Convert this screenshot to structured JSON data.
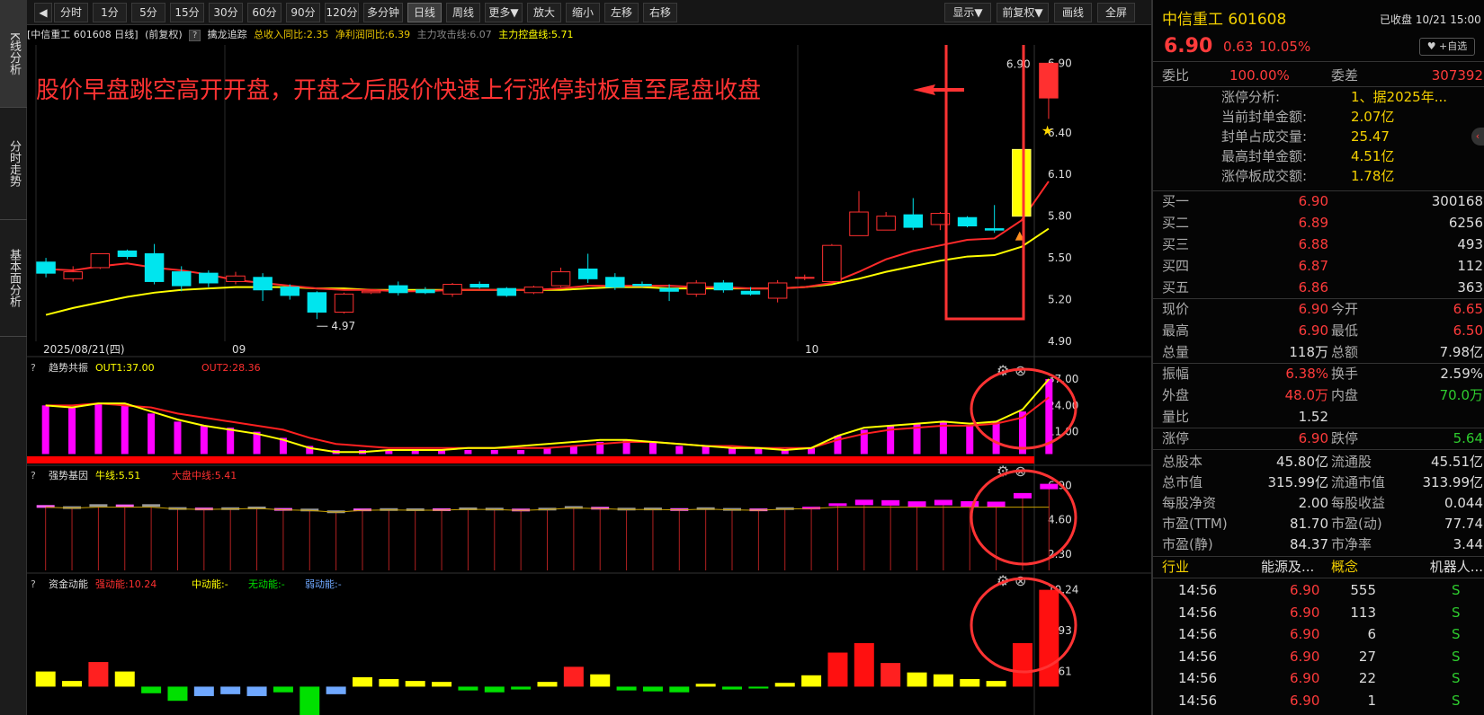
{
  "left_tabs": [
    "K线分析",
    "分时走势",
    "基本面分析"
  ],
  "toolbar": {
    "back_icon": "back-arrow-icon",
    "buttons": [
      "分时",
      "1分",
      "5分",
      "15分",
      "30分",
      "60分",
      "90分",
      "120分",
      "多分钟",
      "日线",
      "周线",
      "更多▼",
      "放大",
      "缩小",
      "左移",
      "右移"
    ],
    "active": "日线",
    "right_buttons": [
      "显示▼",
      "前复权▼",
      "画线",
      "全屏"
    ]
  },
  "info": {
    "name": "[中信重工 601608 日线]",
    "adj": "(前复权)",
    "q": "?",
    "indicator": "擒龙追踪",
    "t1": "总收入同比:2.35",
    "t2": "净利润同比:6.39",
    "t3": "主力攻击线:6.07",
    "t4": "主力控盘线:5.71"
  },
  "annotation": "股价早盘跳空高开开盘，开盘之后股价快速上行涨停封板直至尾盘收盘",
  "colors": {
    "up": "#ff3030",
    "down": "#00e5ee",
    "ma1": "#ff2a2a",
    "ma2": "#ffff00",
    "bar": "#ff00ff"
  },
  "chart_data": {
    "type": "candlestick",
    "x_labels": [
      "2025/08/21(四)",
      "09",
      "10"
    ],
    "y_ticks": [
      "6.90",
      "6.40",
      "6.10",
      "5.80",
      "5.50",
      "5.20",
      "4.90"
    ],
    "ylim": [
      4.9,
      6.98
    ],
    "labels": {
      "high_label": "6.90",
      "low_label": "4.97"
    },
    "candles": [
      [
        5.47,
        5.39,
        5.5,
        5.36
      ],
      [
        5.35,
        5.4,
        5.44,
        5.33
      ],
      [
        5.43,
        5.53,
        5.53,
        5.42
      ],
      [
        5.55,
        5.51,
        5.56,
        5.49
      ],
      [
        5.53,
        5.33,
        5.6,
        5.31
      ],
      [
        5.4,
        5.3,
        5.44,
        5.26
      ],
      [
        5.39,
        5.32,
        5.41,
        5.29
      ],
      [
        5.33,
        5.37,
        5.4,
        5.31
      ],
      [
        5.36,
        5.27,
        5.39,
        5.19
      ],
      [
        5.29,
        5.23,
        5.31,
        5.2
      ],
      [
        5.25,
        5.11,
        5.26,
        5.06
      ],
      [
        5.11,
        5.24,
        5.25,
        5.1
      ],
      [
        5.25,
        5.26,
        5.27,
        5.24
      ],
      [
        5.3,
        5.25,
        5.33,
        5.23
      ],
      [
        5.27,
        5.25,
        5.29,
        5.24
      ],
      [
        5.24,
        5.31,
        5.32,
        5.22
      ],
      [
        5.31,
        5.29,
        5.33,
        5.28
      ],
      [
        5.28,
        5.23,
        5.29,
        5.22
      ],
      [
        5.25,
        5.29,
        5.3,
        5.24
      ],
      [
        5.3,
        5.4,
        5.43,
        5.29
      ],
      [
        5.42,
        5.35,
        5.53,
        5.32
      ],
      [
        5.36,
        5.29,
        5.39,
        5.27
      ],
      [
        5.31,
        5.3,
        5.33,
        5.29
      ],
      [
        5.28,
        5.26,
        5.31,
        5.19
      ],
      [
        5.24,
        5.32,
        5.34,
        5.22
      ],
      [
        5.32,
        5.27,
        5.34,
        5.25
      ],
      [
        5.26,
        5.24,
        5.29,
        5.23
      ],
      [
        5.21,
        5.32,
        5.34,
        5.18
      ],
      [
        5.36,
        5.36,
        5.38,
        5.34
      ],
      [
        5.33,
        5.59,
        5.6,
        5.33
      ],
      [
        5.66,
        5.83,
        5.98,
        5.66
      ],
      [
        5.7,
        5.8,
        5.83,
        5.7
      ],
      [
        5.81,
        5.72,
        5.93,
        5.7
      ],
      [
        5.74,
        5.82,
        5.83,
        5.7
      ],
      [
        5.79,
        5.73,
        5.8,
        5.72
      ],
      [
        5.71,
        5.7,
        5.88,
        5.68
      ],
      [
        5.8,
        6.28,
        6.28,
        5.8
      ],
      [
        6.65,
        6.9,
        6.9,
        6.5
      ]
    ],
    "ma1": [
      5.42,
      5.41,
      5.44,
      5.46,
      5.43,
      5.41,
      5.38,
      5.34,
      5.32,
      5.3,
      5.28,
      5.27,
      5.27,
      5.26,
      5.26,
      5.27,
      5.27,
      5.27,
      5.27,
      5.28,
      5.3,
      5.3,
      5.3,
      5.3,
      5.29,
      5.29,
      5.28,
      5.28,
      5.29,
      5.32,
      5.4,
      5.49,
      5.55,
      5.59,
      5.63,
      5.64,
      5.77,
      6.05
    ],
    "ma2": [
      5.09,
      5.14,
      5.18,
      5.22,
      5.25,
      5.27,
      5.28,
      5.29,
      5.29,
      5.29,
      5.28,
      5.28,
      5.27,
      5.27,
      5.27,
      5.27,
      5.27,
      5.27,
      5.27,
      5.27,
      5.28,
      5.29,
      5.29,
      5.28,
      5.28,
      5.28,
      5.28,
      5.28,
      5.29,
      5.31,
      5.35,
      5.4,
      5.44,
      5.48,
      5.51,
      5.52,
      5.58,
      5.71
    ],
    "ind1": {
      "title": "趋势共振",
      "out1": "OUT1:37.00",
      "out2": "OUT2:28.36",
      "ticks": [
        "37.00",
        "24.00",
        "11.00"
      ],
      "ylim": [
        -2,
        37
      ],
      "bars": [
        24,
        23,
        25,
        25,
        20,
        16,
        14,
        13,
        11,
        8,
        4,
        2,
        2,
        2,
        2,
        2,
        2,
        2,
        2,
        3,
        4,
        6,
        7,
        6,
        4,
        4,
        3,
        3,
        2,
        3,
        9,
        12,
        14,
        15,
        16,
        14,
        16,
        21,
        37
      ],
      "line1": [
        24,
        23,
        25,
        25,
        21,
        17,
        14,
        12,
        10,
        7,
        3,
        1,
        1,
        2,
        2,
        2,
        3,
        3,
        4,
        5,
        6,
        7,
        7,
        6,
        5,
        4,
        3,
        3,
        2,
        3,
        9,
        13,
        14,
        15,
        16,
        15,
        16,
        22,
        37
      ],
      "line2": [
        24,
        24,
        25,
        24,
        23,
        20,
        18,
        16,
        14,
        12,
        8,
        5,
        4,
        3,
        3,
        3,
        3,
        3,
        3,
        3,
        4,
        5,
        6,
        6,
        5,
        4,
        4,
        3,
        3,
        3,
        7,
        10,
        12,
        13,
        14,
        14,
        15,
        18,
        28
      ]
    },
    "ind2": {
      "title": "强势基因",
      "l1": "牛线:5.51",
      "l2": "大盘中线:5.41",
      "ticks": [
        "6.90",
        "4.60",
        "2.30"
      ],
      "ylim": [
        1.2,
        7.3
      ],
      "bars": [
        5.47,
        5.39,
        5.53,
        5.51,
        5.53,
        5.33,
        5.3,
        5.32,
        5.37,
        5.27,
        5.23,
        5.11,
        5.24,
        5.26,
        5.25,
        5.25,
        5.31,
        5.29,
        5.23,
        5.29,
        5.4,
        5.35,
        5.29,
        5.3,
        5.26,
        5.32,
        5.27,
        5.24,
        5.32,
        5.36,
        5.59,
        5.83,
        5.8,
        5.72,
        5.82,
        5.73,
        5.7,
        6.28,
        6.9
      ]
    },
    "ind3": {
      "title": "资金动能",
      "l1": "强动能:10.24",
      "l2": "中动能:-",
      "l3": "无动能:-",
      "l4": "弱动能:-",
      "ticks": [
        "10.24",
        "5.93",
        "1.61"
      ],
      "ylim": [
        -3,
        10.3
      ],
      "bars": [
        1.6,
        0.6,
        2.6,
        1.6,
        -0.7,
        -1.5,
        -1.0,
        -0.8,
        -1.0,
        -0.6,
        -3.0,
        -0.8,
        1.0,
        0.8,
        0.6,
        0.5,
        -0.4,
        -0.6,
        -0.3,
        0.5,
        2.1,
        1.3,
        -0.4,
        -0.5,
        -0.6,
        0.3,
        -0.3,
        -0.2,
        0.4,
        1.2,
        3.6,
        4.6,
        2.5,
        1.5,
        1.3,
        0.8,
        0.6,
        4.6,
        10.24
      ]
    }
  },
  "right": {
    "title": "中信重工 601608",
    "status": "已收盘 10/21 15:00",
    "price": "6.90",
    "chg": "0.63",
    "pct": "10.05%",
    "fav": "♥ +自选",
    "weibi_label": "委比",
    "weibi": "100.00%",
    "weicha_label": "委差",
    "weicha": "307392",
    "zt": [
      [
        "涨停分析:",
        "1、据2025年..."
      ],
      [
        "当前封单金额:",
        "2.07亿"
      ],
      [
        "封单占成交量:",
        "25.47"
      ],
      [
        "最高封单金额:",
        "4.51亿"
      ],
      [
        "涨停板成交额:",
        "1.78亿"
      ]
    ],
    "buys": [
      [
        "买一",
        "6.90",
        "300168"
      ],
      [
        "买二",
        "6.89",
        "6256"
      ],
      [
        "买三",
        "6.88",
        "493"
      ],
      [
        "买四",
        "6.87",
        "112"
      ],
      [
        "买五",
        "6.86",
        "363"
      ]
    ],
    "stats": [
      [
        "现价",
        "6.90",
        "今开",
        "6.65"
      ],
      [
        "最高",
        "6.90",
        "最低",
        "6.50"
      ],
      [
        "总量",
        "118万",
        "总额",
        "7.98亿"
      ],
      [
        "振幅",
        "6.38%",
        "换手",
        "2.59%"
      ],
      [
        "外盘",
        "48.0万",
        "内盘",
        "70.0万"
      ],
      [
        "量比",
        "1.52",
        "",
        ""
      ],
      [
        "涨停",
        "6.90",
        "跌停",
        "5.64"
      ]
    ],
    "fund": [
      [
        "总股本",
        "45.80亿",
        "流通股",
        "45.51亿"
      ],
      [
        "总市值",
        "315.99亿",
        "流通市值",
        "313.99亿"
      ],
      [
        "每股净资",
        "2.00",
        "每股收益",
        "0.044"
      ],
      [
        "市盈(TTM)",
        "81.70",
        "市盈(动)",
        "77.74"
      ],
      [
        "市盈(静)",
        "84.37",
        "市净率",
        "3.44"
      ]
    ],
    "industry": [
      "行业",
      "能源及...",
      "概念",
      "机器人..."
    ],
    "ticks": [
      [
        "14:56",
        "6.90",
        "555",
        "S"
      ],
      [
        "14:56",
        "6.90",
        "113",
        "S"
      ],
      [
        "14:56",
        "6.90",
        "6",
        "S"
      ],
      [
        "14:56",
        "6.90",
        "27",
        "S"
      ],
      [
        "14:56",
        "6.90",
        "22",
        "S"
      ],
      [
        "14:56",
        "6.90",
        "1",
        "S"
      ]
    ]
  }
}
